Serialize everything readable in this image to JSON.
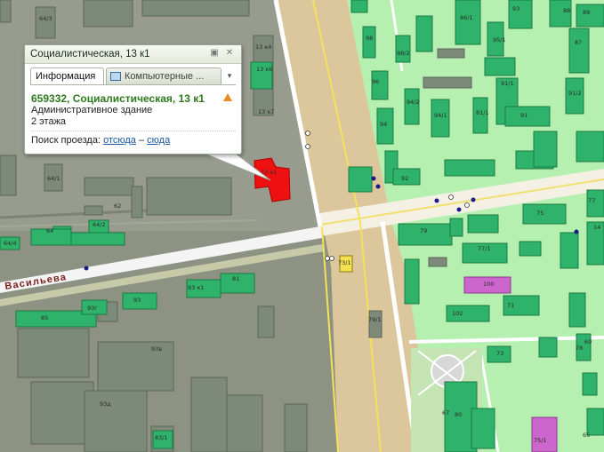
{
  "popup": {
    "title": "Социалистическая, 13 к1",
    "tab_info": "Информация",
    "tab_companies": "Компьютерные ...",
    "address": "659332, Социалистическая, 13 к1",
    "building_type": "Административное здание",
    "floors": "2 этажа",
    "route_label": "Поиск проезда:",
    "route_from": "отсюда",
    "route_dash": "–",
    "route_to": "сюда"
  },
  "map": {
    "street_label": "Васильева",
    "building_labels": [
      "64/3",
      "13 к4",
      "13 к6",
      "13 к7",
      "13 к1",
      "64/1",
      "62",
      "64",
      "64/2",
      "64/4",
      "93 к1",
      "81",
      "85",
      "93г",
      "93",
      "93в",
      "93д",
      "83/1",
      "98",
      "98/2",
      "86/1",
      "96",
      "94/2",
      "94",
      "94/1",
      "92",
      "93",
      "95/1",
      "91",
      "88",
      "91/1",
      "81/1",
      "87",
      "89",
      "91/2",
      "79",
      "75",
      "77/1",
      "77",
      "100",
      "102",
      "71",
      "78",
      "67",
      "73",
      "69",
      "80",
      "75/1",
      "73/1",
      "79/1",
      "65",
      "14"
    ],
    "colors": {
      "residential_zone": "#b6f0b0",
      "industrial_zone": "#8d9283",
      "main_road": "#dcc79c",
      "building": "#2fb36a",
      "selected_building": "#ee1111",
      "special_building": "#cc66cc"
    }
  }
}
